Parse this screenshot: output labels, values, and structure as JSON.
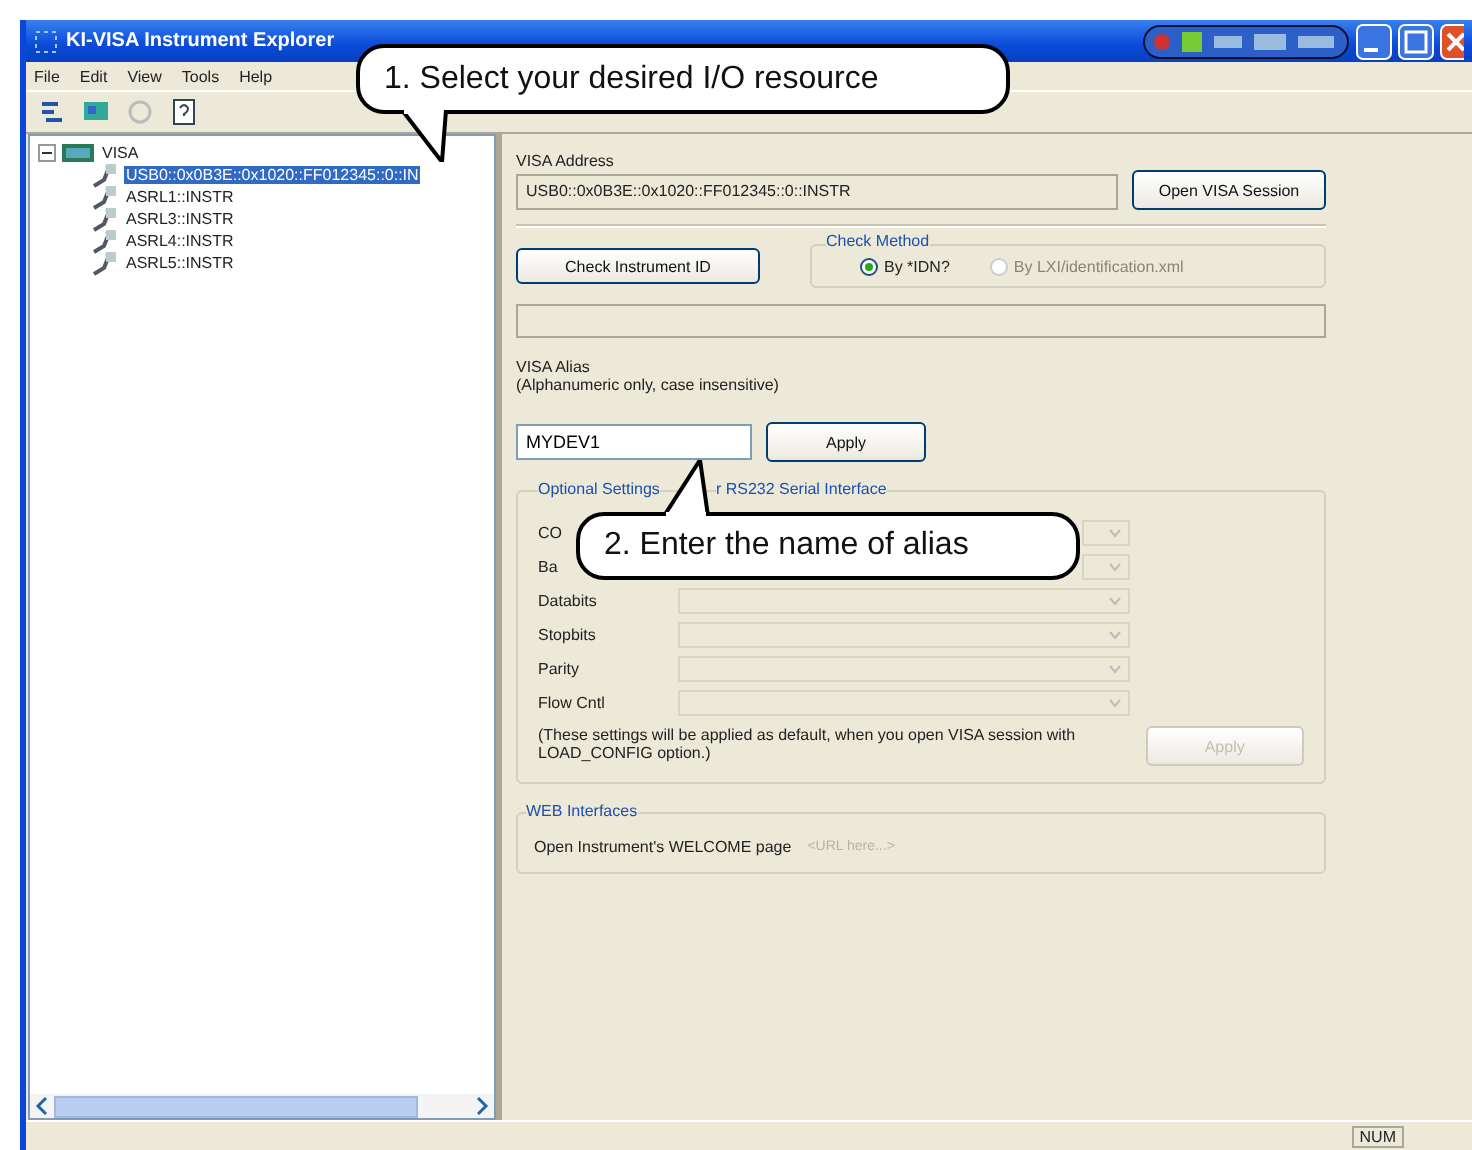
{
  "window": {
    "title": "KI-VISA Instrument Explorer"
  },
  "menu": [
    "File",
    "Edit",
    "View",
    "Tools",
    "Help"
  ],
  "tree": {
    "label": "VISA",
    "expanded": true,
    "children": [
      {
        "label": "USB0::0x0B3E::0x1020::FF012345::0::IN",
        "selected": true
      },
      {
        "label": "ASRL1::INSTR",
        "selected": false
      },
      {
        "label": "ASRL3::INSTR",
        "selected": false
      },
      {
        "label": "ASRL4::INSTR",
        "selected": false
      },
      {
        "label": "ASRL5::INSTR",
        "selected": false
      }
    ]
  },
  "visa_address": {
    "label": "VISA Address",
    "value": "USB0::0x0B3E::0x1020::FF012345::0::INSTR",
    "button": "Open VISA Session"
  },
  "check": {
    "button": "Check Instrument ID",
    "group": "Check Method",
    "options": [
      {
        "label": "By *IDN?",
        "selected": true,
        "disabled": false
      },
      {
        "label": "By LXI/identification.xml",
        "selected": false,
        "disabled": true
      }
    ]
  },
  "alias": {
    "label": "VISA Alias",
    "hint": "(Alphanumeric only, case insensitive)",
    "value": "MYDEV1",
    "button": "Apply"
  },
  "serial": {
    "group_visible": [
      "Optional Settings",
      "r RS232 Serial Interface"
    ],
    "fields": [
      {
        "label": "CO",
        "disabled": true
      },
      {
        "label": "Ba",
        "disabled": true
      },
      {
        "label": "Databits",
        "disabled": true
      },
      {
        "label": "Stopbits",
        "disabled": true
      },
      {
        "label": "Parity",
        "disabled": true
      },
      {
        "label": "Flow Cntl",
        "disabled": true
      }
    ],
    "note": "(These settings will be applied as default, when you open VISA session with LOAD_CONFIG option.)",
    "button": "Apply",
    "button_disabled": true
  },
  "web": {
    "group": "WEB Interfaces",
    "label": "Open Instrument's WELCOME page",
    "placeholder": "<URL here...>"
  },
  "status_bar": {
    "indicator": "NUM"
  },
  "callouts": [
    "1. Select your desired I/O resource",
    "2. Enter the name of alias"
  ]
}
